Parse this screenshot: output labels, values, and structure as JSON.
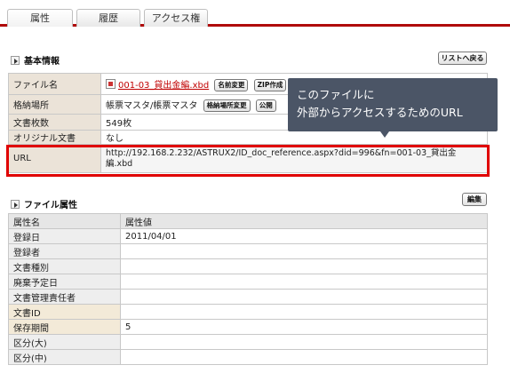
{
  "tabs": [
    {
      "label": "属性"
    },
    {
      "label": "履歴"
    },
    {
      "label": "アクセス権"
    }
  ],
  "basic": {
    "title": "基本情報",
    "back_button": "リストへ戻る",
    "rows": {
      "filename": {
        "label": "ファイル名",
        "value": "001-03_貸出金編.xbd",
        "btn_rename": "名前変更",
        "btn_zip": "ZIP作成"
      },
      "location": {
        "label": "格納場所",
        "value": "帳票マスタ/帳票マスタ",
        "btn_change": "格納場所変更",
        "btn_public": "公開"
      },
      "pages": {
        "label": "文書枚数",
        "value": "549枚"
      },
      "original": {
        "label": "オリジナル文書",
        "value": "なし"
      },
      "url": {
        "label": "URL",
        "value": "http://192.168.2.232/ASTRUX2/ID_doc_reference.aspx?did=996&fn=001-03_貸出金編.xbd"
      }
    }
  },
  "callout": {
    "line1": "このファイルに",
    "line2": "外部からアクセスするためのURL"
  },
  "attributes": {
    "title": "ファイル属性",
    "edit_button": "編集",
    "header": {
      "name": "属性名",
      "value": "属性値"
    },
    "rows": [
      {
        "name": "登録日",
        "value": "2011/04/01"
      },
      {
        "name": "登録者",
        "value": ""
      },
      {
        "name": "文書種別",
        "value": ""
      },
      {
        "name": "廃棄予定日",
        "value": ""
      },
      {
        "name": "文書管理責任者",
        "value": ""
      },
      {
        "name": "文書ID",
        "value": ""
      },
      {
        "name": "保存期間",
        "value": "5"
      },
      {
        "name": "区分(大)",
        "value": ""
      },
      {
        "name": "区分(中)",
        "value": ""
      }
    ]
  },
  "colors": {
    "accent": "#c00000",
    "callout_bg": "#4b5566",
    "highlight": "#e00000"
  }
}
